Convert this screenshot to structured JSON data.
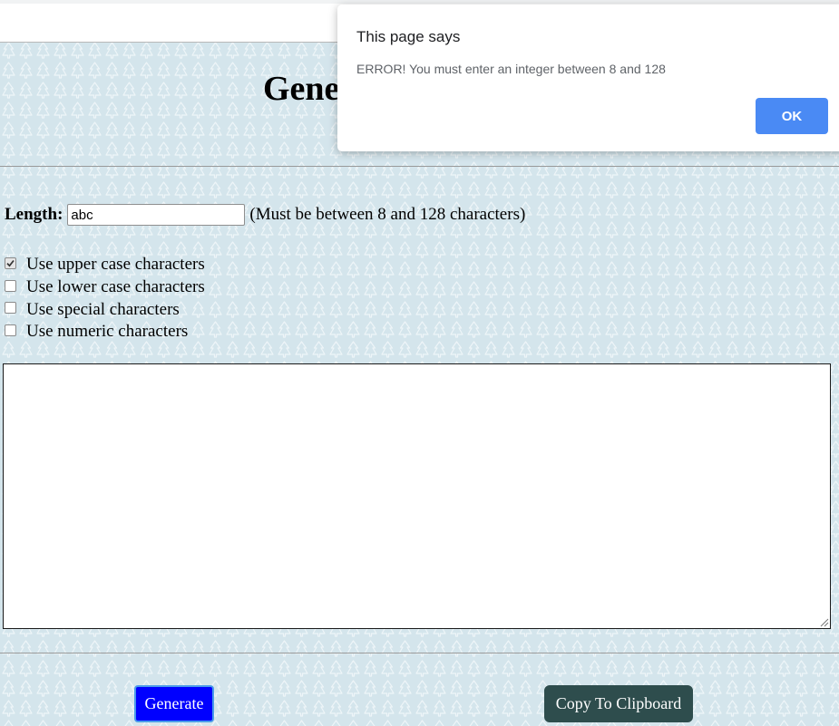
{
  "page": {
    "title": "Gene"
  },
  "form": {
    "length_label": "Length:",
    "length_value": "abc",
    "length_hint": "(Must be between 8 and 128 characters)",
    "options": [
      {
        "label": "Use upper case characters",
        "checked": true
      },
      {
        "label": "Use lower case characters",
        "checked": false
      },
      {
        "label": "Use special characters",
        "checked": false
      },
      {
        "label": "Use numeric characters",
        "checked": false
      }
    ],
    "output_value": ""
  },
  "buttons": {
    "generate": "Generate",
    "copy": "Copy To Clipboard"
  },
  "dialog": {
    "title": "This page says",
    "message": "ERROR! You must enter an integer between 8 and 128",
    "ok": "OK"
  },
  "colors": {
    "background": "#d4e5ec",
    "generate_button": "#0000ff",
    "copy_button": "#2e4d4d",
    "dialog_ok": "#4a8af4"
  }
}
